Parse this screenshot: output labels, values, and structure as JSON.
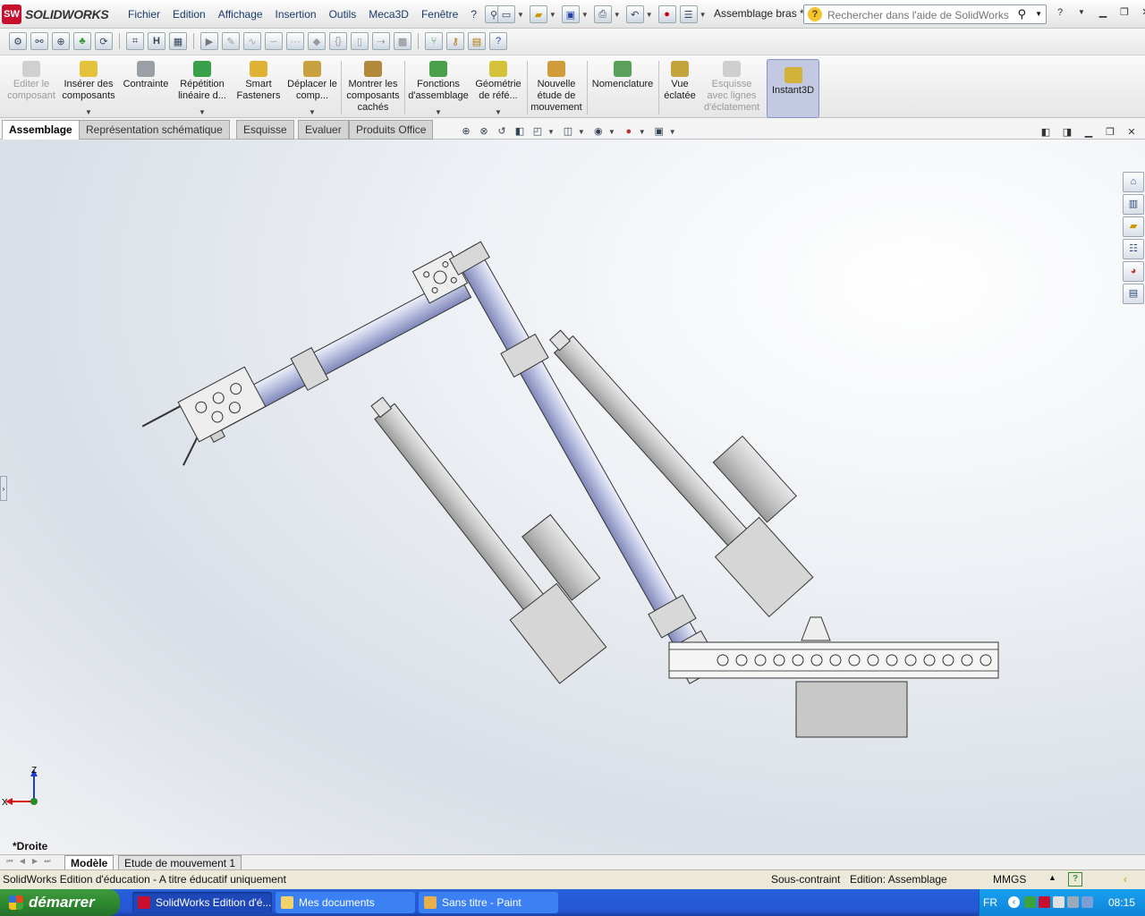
{
  "app": {
    "brand": "SOLIDWORKS",
    "logo_mark": "SW"
  },
  "menu": [
    "Fichier",
    "Edition",
    "Affichage",
    "Insertion",
    "Outils",
    "Meca3D",
    "Fenêtre",
    "?"
  ],
  "document_title": "Assemblage bras *",
  "search": {
    "placeholder": "Rechercher dans l'aide de SolidWorks"
  },
  "commands": [
    {
      "label": "Editer le composant",
      "icon": "edit-component-icon",
      "disabled": true
    },
    {
      "label": "Insérer des composants",
      "icon": "insert-components-icon",
      "dropdown": true
    },
    {
      "label": "Contrainte",
      "icon": "mate-icon"
    },
    {
      "label": "Répétition linéaire d...",
      "icon": "linear-pattern-icon",
      "dropdown": true
    },
    {
      "label": "Smart Fasteners",
      "icon": "smart-fasteners-icon"
    },
    {
      "label": "Déplacer le comp...",
      "icon": "move-component-icon",
      "dropdown": true
    },
    {
      "label": "Montrer les composants cachés",
      "icon": "show-hidden-icon"
    },
    {
      "label": "Fonctions d'assemblage",
      "icon": "assembly-features-icon",
      "dropdown": true
    },
    {
      "label": "Géométrie de réfé...",
      "icon": "reference-geometry-icon",
      "dropdown": true
    },
    {
      "label": "Nouvelle étude de mouvement",
      "icon": "motion-study-icon"
    },
    {
      "label": "Nomenclature",
      "icon": "bom-icon"
    },
    {
      "label": "Vue éclatée",
      "icon": "exploded-view-icon"
    },
    {
      "label": "Esquisse avec lignes d'éclatement",
      "icon": "explode-line-sketch-icon",
      "disabled": true
    },
    {
      "label": "Instant3D",
      "icon": "instant3d-icon",
      "active": true
    }
  ],
  "tabs": [
    "Assemblage",
    "Représentation schématique",
    "Esquisse",
    "Evaluer",
    "Produits Office"
  ],
  "active_tab": "Assemblage",
  "triad": {
    "z": "Z",
    "x": "X"
  },
  "view_name": "*Droite",
  "bottom_tabs": [
    "Modèle",
    "Etude de mouvement 1"
  ],
  "status": {
    "left": "SolidWorks Edition d'éducation - A titre éducatif uniquement",
    "constraint": "Sous-contraint",
    "mode": "Edition: Assemblage",
    "units": "MMGS"
  },
  "taskbar": {
    "start": "démarrer",
    "tasks": [
      "SolidWorks Edition d'é...",
      "Mes documents",
      "Sans titre - Paint"
    ],
    "lang": "FR",
    "clock": "08:15"
  },
  "colors": {
    "tube": "#b7bdde",
    "actuator": "#c7c7c7",
    "start_green": "#3a8f3a",
    "taskbar_blue": "#245edc"
  }
}
